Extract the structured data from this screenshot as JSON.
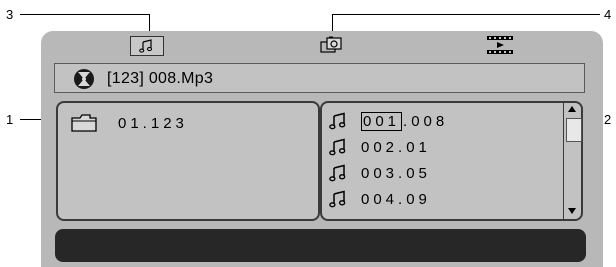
{
  "callouts": {
    "c1": "1",
    "c2": "2",
    "c3": "3",
    "c4": "4"
  },
  "toolbar": {
    "icons": [
      "music-tab-icon",
      "photo-tab-icon",
      "movie-tab-icon"
    ],
    "selected": "music-tab-icon"
  },
  "titlebar": {
    "text": "[123] 008.Mp3",
    "icon": "disc-icon"
  },
  "folder": {
    "icon": "folder-icon",
    "name": "01.123"
  },
  "files": [
    {
      "prefix": "001",
      "suffix": ".008",
      "selected": true
    },
    {
      "prefix": "",
      "suffix": "002.01",
      "selected": false
    },
    {
      "prefix": "",
      "suffix": "003.05",
      "selected": false
    },
    {
      "prefix": "",
      "suffix": "004.09",
      "selected": false
    }
  ],
  "scrollbar": {
    "up_icon": "scroll-up-arrow-icon",
    "down_icon": "scroll-down-arrow-icon"
  }
}
